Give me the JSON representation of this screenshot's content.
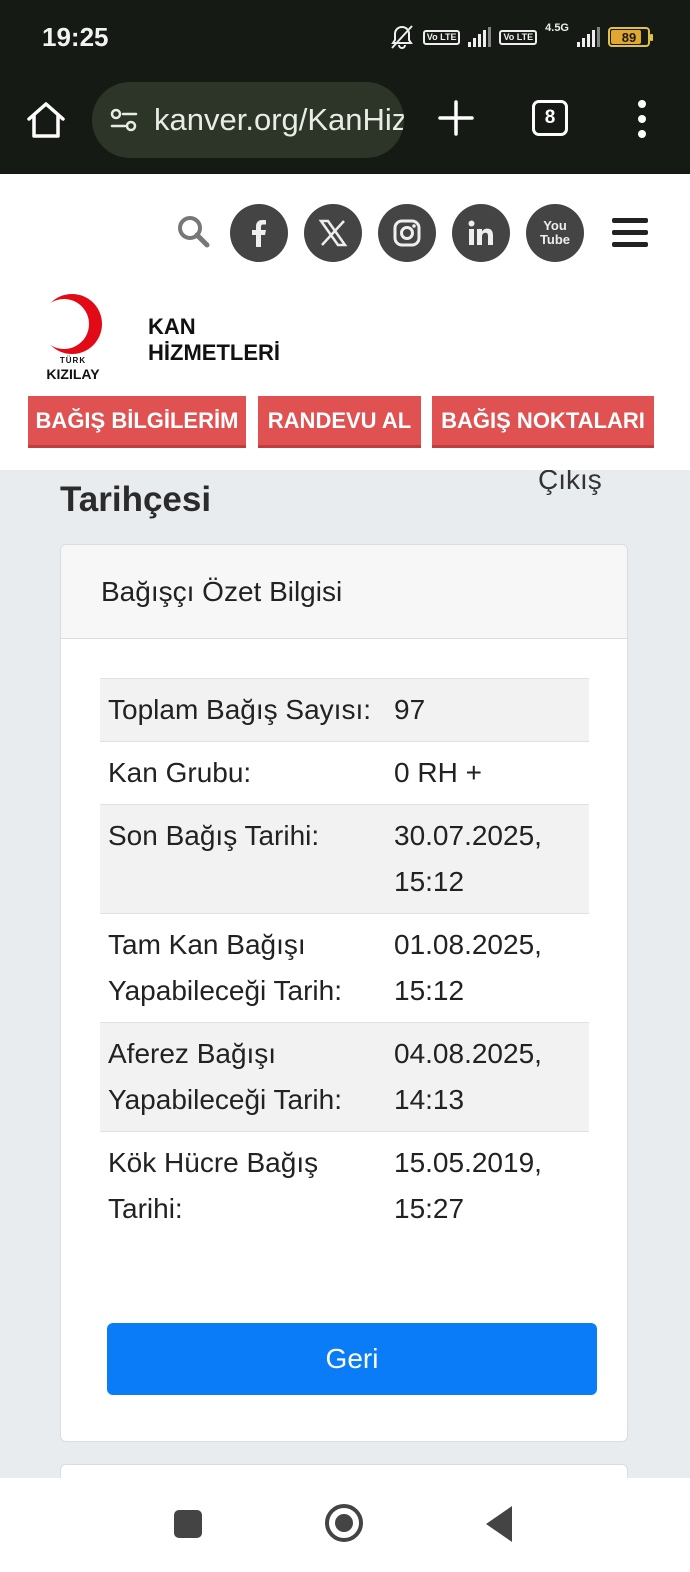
{
  "status_bar": {
    "time": "19:25",
    "sim1_badge": "Vo LTE",
    "sim2_badge": "Vo LTE",
    "network": "4.5G",
    "battery": "89",
    "icons": [
      "mute-bell-icon",
      "signal-icon",
      "battery-icon"
    ]
  },
  "browser": {
    "url": "kanver.org/KanHizmetleri",
    "tab_count": "8",
    "icons": [
      "home-icon",
      "site-settings-icon",
      "plus-icon",
      "tabs-icon",
      "kebab-menu-icon"
    ]
  },
  "header": {
    "social_icons": [
      "facebook-icon",
      "x-icon",
      "instagram-icon",
      "linkedin-icon",
      "youtube-icon"
    ],
    "youtube_label": "You Tube",
    "logo_small": "TÜRK",
    "logo_big": "KIZILAY",
    "brand_line1": "KAN",
    "brand_line2": "HİZMETLERİ",
    "nav": [
      "BAĞIŞ BİLGİLERİM",
      "RANDEVU AL",
      "BAĞIŞ NOKTALARI"
    ]
  },
  "page": {
    "title": "Tarihçesi",
    "logout": "Çıkış"
  },
  "card": {
    "header": "Bağışçı Özet Bilgisi",
    "rows": [
      {
        "label": "Toplam Bağış Sayısı:",
        "value": "97"
      },
      {
        "label": "Kan Grubu:",
        "value": "0 RH +"
      },
      {
        "label": "Son Bağış Tarihi:",
        "value": "30.07.2025, 15:12"
      },
      {
        "label": "Tam Kan Bağışı Yapabileceği Tarih:",
        "value": "01.08.2025, 15:12"
      },
      {
        "label": "Aferez Bağışı Yapabileceği Tarih:",
        "value": "04.08.2025, 14:13"
      },
      {
        "label": "Kök Hücre Bağış Tarihi:",
        "value": "15.05.2019, 15:27"
      }
    ],
    "button": "Geri"
  },
  "colors": {
    "nav_red": "#e05252",
    "primary_blue": "#0a7cf8",
    "logo_red": "#e30a17"
  }
}
